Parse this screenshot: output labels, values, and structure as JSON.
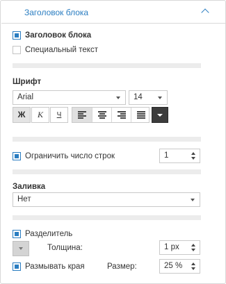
{
  "section": {
    "title": "Заголовок блока"
  },
  "options": {
    "block_title": {
      "label": "Заголовок блока",
      "checked": true
    },
    "special_text": {
      "label": "Специальный текст",
      "checked": false
    }
  },
  "font": {
    "heading": "Шрифт",
    "family": "Arial",
    "size": "14",
    "bold_label": "Ж",
    "italic_label": "К",
    "underline_label": "Ч",
    "bold_pressed": true,
    "alignment_selected": "left"
  },
  "limit_lines": {
    "label": "Ограничить число строк",
    "checked": true,
    "value": "1"
  },
  "fill": {
    "heading": "Заливка",
    "value": "Нет"
  },
  "separator": {
    "label": "Разделитель",
    "checked": true,
    "color": "#d4d4d4",
    "thickness_label": "Толщина:",
    "thickness_value": "1 px"
  },
  "blur_edges": {
    "label": "Размывать края",
    "checked": true,
    "size_label": "Размер:",
    "size_value": "25 %"
  },
  "colors": {
    "accent": "#2a7dc1",
    "divider": "#ececec",
    "text_color_button": "#3c3c3c"
  }
}
